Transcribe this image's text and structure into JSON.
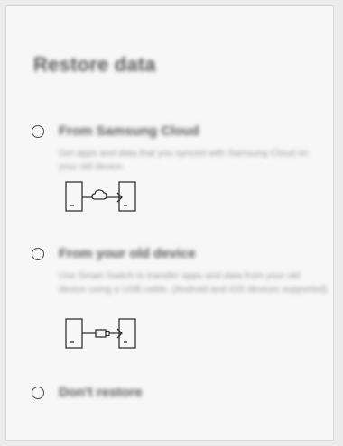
{
  "screen": {
    "title": "Restore data"
  },
  "options": [
    {
      "label": "From Samsung Cloud",
      "description": "Get apps and data that you synced with Samsung Cloud on your old device.",
      "illustration": "phone-cloud-phone-icon"
    },
    {
      "label": "From your old device",
      "description": "Use Smart Switch to transfer apps and data from your old device using a USB cable. (Android and iOS devices supported)",
      "illustration": "phone-usb-phone-icon"
    },
    {
      "label": "Don't restore"
    }
  ],
  "colors": {
    "background": "#f7f7f7",
    "title_text": "#5a5a5a",
    "description_text": "#9a9a9a",
    "icon_stroke": "#333333"
  }
}
